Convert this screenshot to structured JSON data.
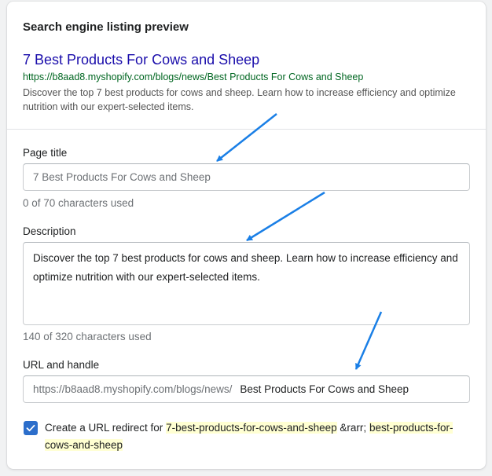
{
  "heading": "Search engine listing preview",
  "preview": {
    "title": "7 Best Products For Cows and Sheep",
    "url": "https://b8aad8.myshopify.com/blogs/news/Best Products For Cows and Sheep",
    "description": "Discover the top 7 best products for cows and sheep. Learn how to increase efficiency and optimize nutrition with our expert-selected items."
  },
  "page_title": {
    "label": "Page title",
    "placeholder": "7 Best Products For Cows and Sheep",
    "help": "0 of 70 characters used"
  },
  "description_field": {
    "label": "Description",
    "value": "Discover the top 7 best products for cows and sheep. Learn how to increase efficiency and optimize nutrition with our expert-selected items.",
    "help": "140 of 320 characters used"
  },
  "url_handle": {
    "label": "URL and handle",
    "prefix": "https://b8aad8.myshopify.com/blogs/news/",
    "value": "Best Products For Cows and Sheep"
  },
  "redirect": {
    "checked": true,
    "text_before": "Create a URL redirect for ",
    "old_handle": "7-best-products-for-cows-and-sheep",
    "arrow_text": " &rarr; ",
    "new_handle": "best-products-for-cows-and-sheep"
  },
  "colors": {
    "link": "#1a0dab",
    "url_green": "#006621",
    "checkbox": "#2c6ecb",
    "annotation_arrow": "#1a7fe6",
    "highlight": "#ffffd2"
  },
  "icons": [
    "check-icon",
    "annotation-arrow"
  ]
}
